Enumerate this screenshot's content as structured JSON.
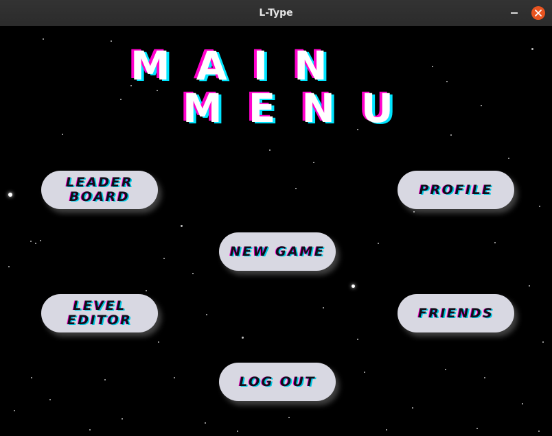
{
  "window": {
    "title": "L-Type"
  },
  "headline": {
    "line1": "MAIN",
    "line2": "MENU"
  },
  "menu": {
    "leaderboard": "LEADER\nBOARD",
    "profile": "PROFILE",
    "new_game": "NEW GAME",
    "level_editor": "LEVEL\nEDITOR",
    "friends": "FRIENDS",
    "log_out": "LOG OUT"
  },
  "colors": {
    "background": "#000000",
    "button": "#d8d8e2",
    "glitch_magenta": "#ff00cc",
    "glitch_cyan": "#00e5ff",
    "close_button": "#e95420"
  },
  "icons": {
    "minimize": "minimize-icon",
    "close": "close-icon"
  }
}
